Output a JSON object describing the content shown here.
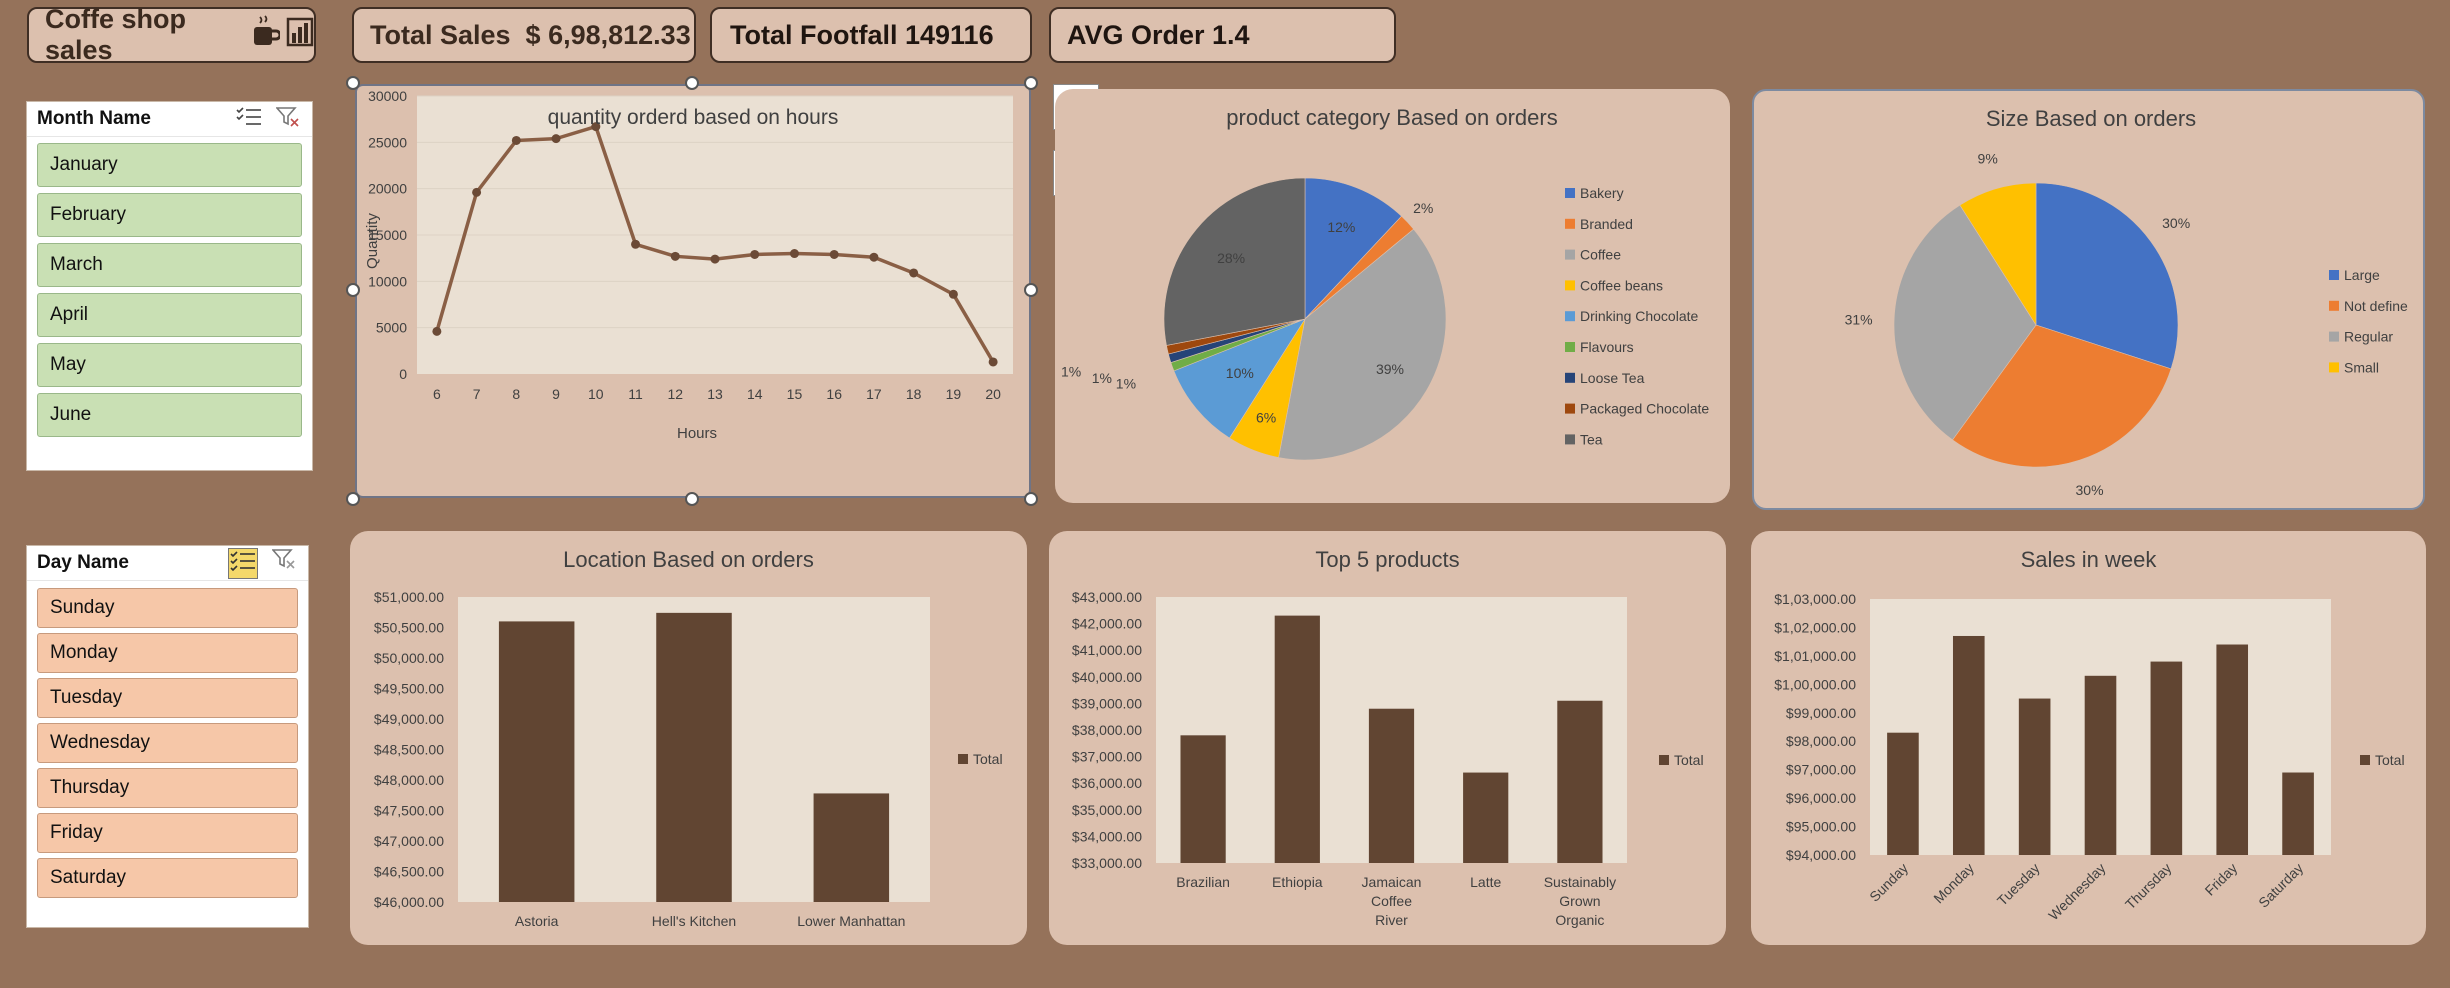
{
  "header": {
    "title": "Coffe shop sales",
    "total_sales": "Total Sales  $ 6,98,812.33",
    "total_footfall": "Total Footfall 149116",
    "avg_order": "AVG Order 1.4"
  },
  "month_slicer": {
    "title": "Month Name",
    "items": [
      "January",
      "February",
      "March",
      "April",
      "May",
      "June"
    ]
  },
  "day_slicer": {
    "title": "Day Name",
    "items": [
      "Sunday",
      "Monday",
      "Tuesday",
      "Wednesday",
      "Thursday",
      "Friday",
      "Saturday"
    ]
  },
  "colors": {
    "background": "#95725a",
    "panel": "#dcc0ae",
    "plot_area": "#eae0d3",
    "bar": "#614532",
    "line": "#8a5f45"
  },
  "chart_data": [
    {
      "type": "line",
      "title": "quantity orderd based on hours",
      "xlabel": "Hours",
      "ylabel": "Quantity",
      "x": [
        6,
        7,
        8,
        9,
        10,
        11,
        12,
        13,
        14,
        15,
        16,
        17,
        18,
        19,
        20
      ],
      "y_ticks": [
        "0",
        "5000",
        "10000",
        "15000",
        "20000",
        "25000",
        "30000"
      ],
      "ylim": [
        0,
        30000
      ],
      "series": [
        {
          "values": [
            4600,
            19600,
            25200,
            25400,
            26700,
            14000,
            12700,
            12400,
            12900,
            13000,
            12900,
            12600,
            10900,
            8600,
            1300
          ]
        }
      ]
    },
    {
      "type": "pie",
      "title": "product category Based on orders",
      "series": [
        {
          "labels": [
            "Bakery",
            "Branded",
            "Coffee",
            "Coffee beans",
            "Drinking Chocolate",
            "Flavours",
            "Loose Tea",
            "Packaged Chocolate",
            "Tea"
          ],
          "values": [
            12,
            2,
            39,
            6,
            10,
            1,
            1,
            1,
            28
          ],
          "data_labels": [
            "12%",
            "2%",
            "39%",
            "6%",
            "10%",
            "1%",
            "1%",
            "1%",
            "28%"
          ],
          "colors": [
            "#4472c4",
            "#ed7d31",
            "#a5a5a5",
            "#ffc000",
            "#5b9bd5",
            "#70ad47",
            "#264478",
            "#9e480e",
            "#636363"
          ]
        }
      ],
      "legend": "right"
    },
    {
      "type": "pie",
      "title": "Size Based on orders",
      "series": [
        {
          "labels": [
            "Large",
            "Not define",
            "Regular",
            "Small"
          ],
          "values": [
            30,
            30,
            31,
            9
          ],
          "data_labels": [
            "30%",
            "30%",
            "31%",
            "9%"
          ],
          "colors": [
            "#4472c4",
            "#ed7d31",
            "#a5a5a5",
            "#ffc000"
          ]
        }
      ],
      "legend": "right"
    },
    {
      "type": "bar",
      "title": "Location Based on orders",
      "categories": [
        "Astoria",
        "Hell's Kitchen",
        "Lower Manhattan"
      ],
      "series": [
        {
          "name": "Total",
          "values": [
            50600,
            50740,
            47780
          ]
        }
      ],
      "ylim": [
        46000,
        51000
      ],
      "y_ticks": [
        "$46,000.00",
        "$46,500.00",
        "$47,000.00",
        "$47,500.00",
        "$48,000.00",
        "$48,500.00",
        "$49,000.00",
        "$49,500.00",
        "$50,000.00",
        "$50,500.00",
        "$51,000.00"
      ],
      "legend": "right"
    },
    {
      "type": "bar",
      "title": "Top 5 products",
      "categories": [
        "Brazilian",
        "Ethiopia",
        "Jamaican Coffee River",
        "Latte",
        "Sustainably Grown Organic"
      ],
      "series": [
        {
          "name": "Total",
          "values": [
            37800,
            42300,
            38800,
            36400,
            39100
          ]
        }
      ],
      "ylim": [
        33000,
        43000
      ],
      "y_ticks": [
        "$33,000.00",
        "$34,000.00",
        "$35,000.00",
        "$36,000.00",
        "$37,000.00",
        "$38,000.00",
        "$39,000.00",
        "$40,000.00",
        "$41,000.00",
        "$42,000.00",
        "$43,000.00"
      ],
      "legend": "right"
    },
    {
      "type": "bar",
      "title": "Sales in week",
      "categories": [
        "Sunday",
        "Monday",
        "Tuesday",
        "Wednesday",
        "Thursday",
        "Friday",
        "Saturday"
      ],
      "series": [
        {
          "name": "Total",
          "values": [
            98300,
            101700,
            99500,
            100300,
            100800,
            101400,
            96900
          ]
        }
      ],
      "ylim": [
        94000,
        103000
      ],
      "y_ticks": [
        "$94,000.00",
        "$95,000.00",
        "$96,000.00",
        "$97,000.00",
        "$98,000.00",
        "$99,000.00",
        "$1,00,000.00",
        "$1,01,000.00",
        "$1,02,000.00",
        "$1,03,000.00"
      ],
      "legend": "right"
    }
  ]
}
